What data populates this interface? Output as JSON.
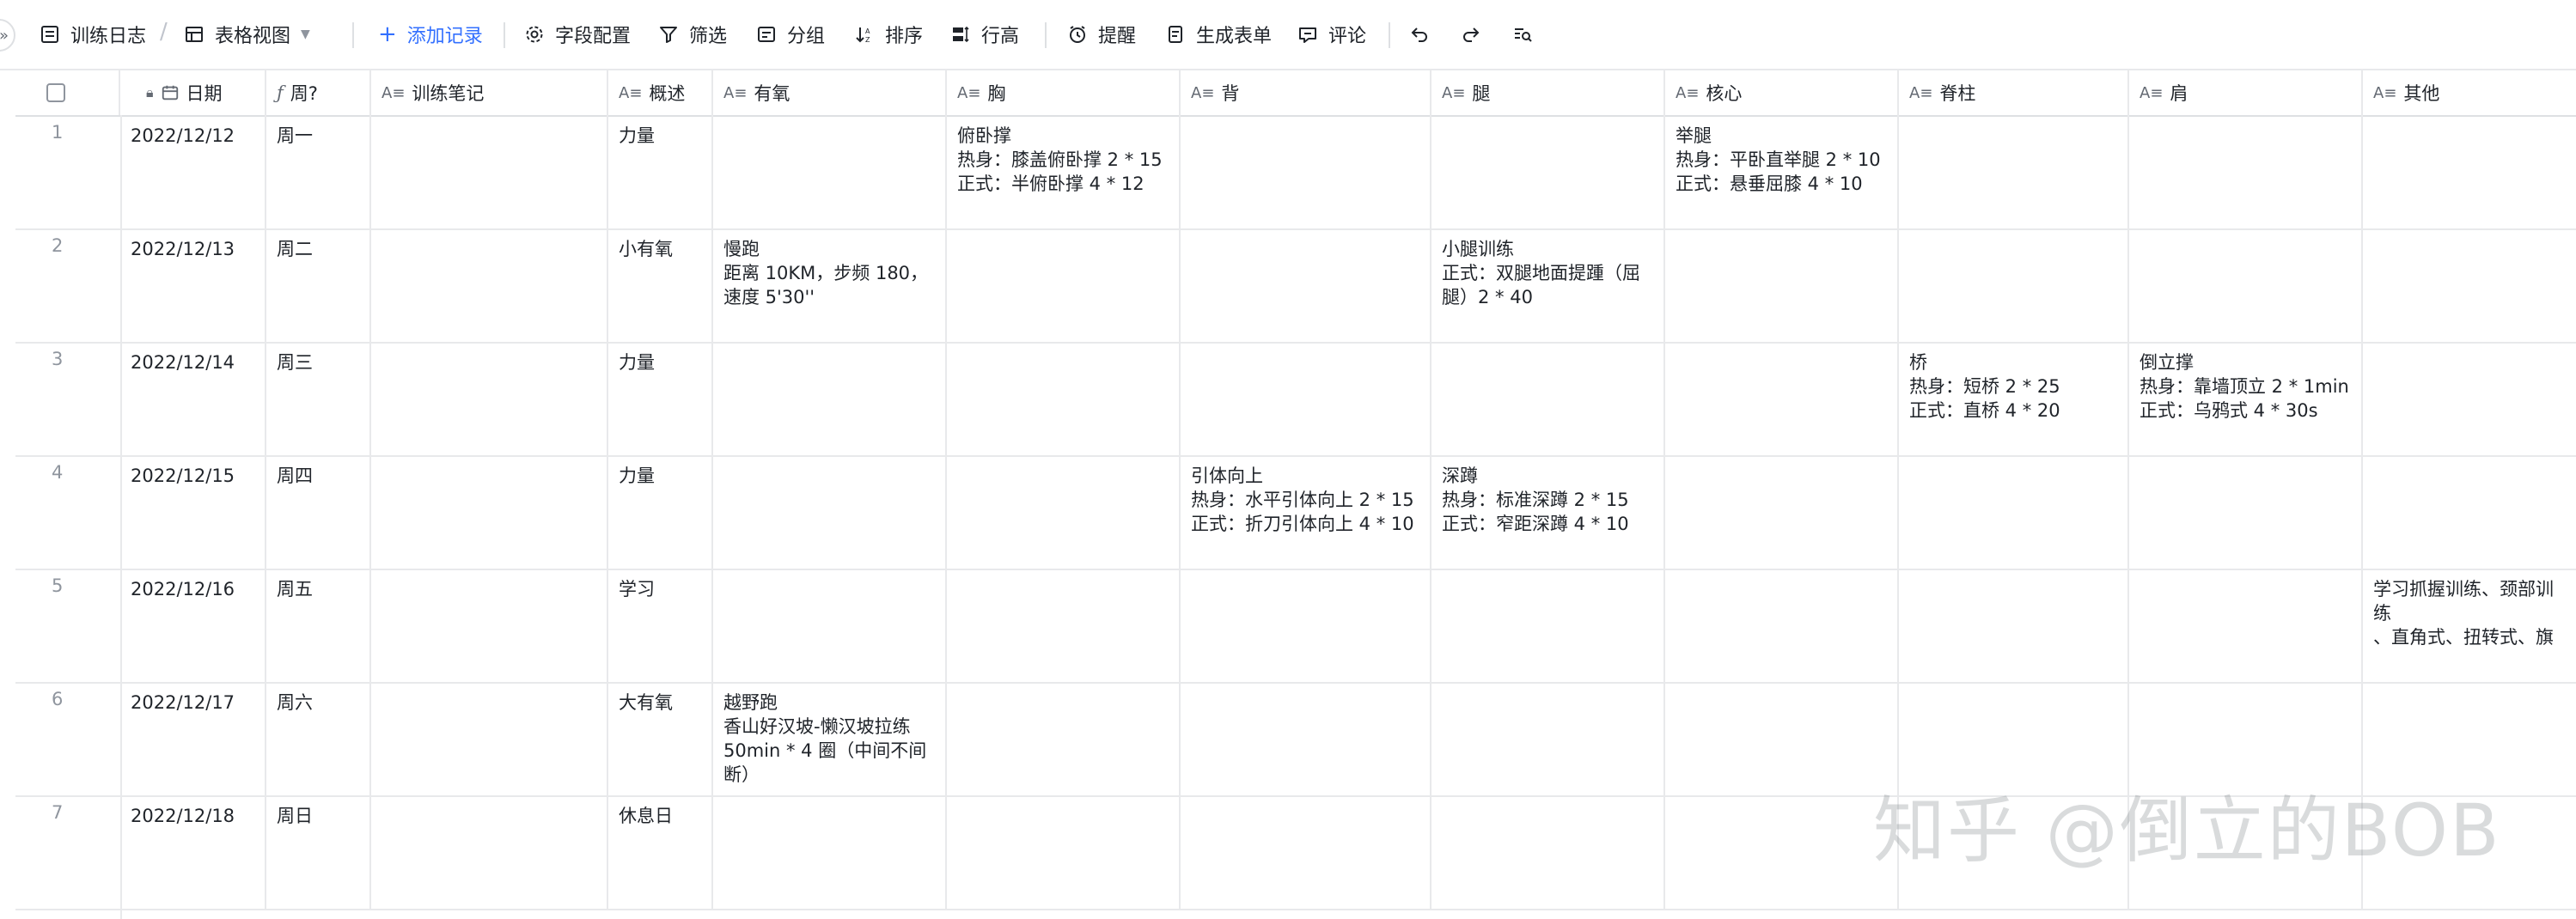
{
  "toolbar": {
    "table_name": "训练日志",
    "view_name": "表格视图",
    "add_record": "添加记录",
    "field_config": "字段配置",
    "filter": "筛选",
    "group": "分组",
    "sort": "排序",
    "row_height": "行高",
    "reminder": "提醒",
    "generate_form": "生成表单",
    "comment": "评论"
  },
  "columns": [
    {
      "key": "date",
      "label": "日期"
    },
    {
      "key": "weekday",
      "label": "周?"
    },
    {
      "key": "notes",
      "label": "训练笔记"
    },
    {
      "key": "summary",
      "label": "概述"
    },
    {
      "key": "cardio",
      "label": "有氧"
    },
    {
      "key": "chest",
      "label": "胸"
    },
    {
      "key": "back",
      "label": "背"
    },
    {
      "key": "legs",
      "label": "腿"
    },
    {
      "key": "core",
      "label": "核心"
    },
    {
      "key": "spine",
      "label": "脊柱"
    },
    {
      "key": "shoulder",
      "label": "肩"
    },
    {
      "key": "other",
      "label": "其他"
    }
  ],
  "rows": [
    {
      "num": "1",
      "date": "2022/12/12",
      "weekday": "周一",
      "notes": "",
      "summary": "力量",
      "cardio": "",
      "chest": "俯卧撑\n热身：膝盖俯卧撑 2 * 15\n正式：半俯卧撑 4 * 12",
      "back": "",
      "legs": "",
      "core": "举腿\n热身：平卧直举腿 2 * 10\n正式：悬垂屈膝 4 * 10",
      "spine": "",
      "shoulder": "",
      "other": ""
    },
    {
      "num": "2",
      "date": "2022/12/13",
      "weekday": "周二",
      "notes": "",
      "summary": "小有氧",
      "cardio": "慢跑\n距离 10KM，步频 180，\n速度 5'30''",
      "chest": "",
      "back": "",
      "legs": "小腿训练\n正式：双腿地面提踵（屈\n腿）2 * 40",
      "core": "",
      "spine": "",
      "shoulder": "",
      "other": ""
    },
    {
      "num": "3",
      "date": "2022/12/14",
      "weekday": "周三",
      "notes": "",
      "summary": "力量",
      "cardio": "",
      "chest": "",
      "back": "",
      "legs": "",
      "core": "",
      "spine": "桥\n热身：短桥 2 * 25\n正式：直桥 4 * 20",
      "shoulder": "倒立撑\n热身：靠墙顶立 2 * 1min\n正式：乌鸦式 4 * 30s",
      "other": ""
    },
    {
      "num": "4",
      "date": "2022/12/15",
      "weekday": "周四",
      "notes": "",
      "summary": "力量",
      "cardio": "",
      "chest": "",
      "back": "引体向上\n热身：水平引体向上 2 * 15\n正式：折刀引体向上 4 * 10",
      "legs": "深蹲\n热身：标准深蹲 2 * 15\n正式：窄距深蹲 4 * 10",
      "core": "",
      "spine": "",
      "shoulder": "",
      "other": ""
    },
    {
      "num": "5",
      "date": "2022/12/16",
      "weekday": "周五",
      "notes": "",
      "summary": "学习",
      "cardio": "",
      "chest": "",
      "back": "",
      "legs": "",
      "core": "",
      "spine": "",
      "shoulder": "",
      "other": "学习抓握训练、颈部训练\n、直角式、扭转式、旗"
    },
    {
      "num": "6",
      "date": "2022/12/17",
      "weekday": "周六",
      "notes": "",
      "summary": "大有氧",
      "cardio": "越野跑\n香山好汉坡-懒汉坡拉练\n50min * 4 圈（中间不间\n断）",
      "chest": "",
      "back": "",
      "legs": "",
      "core": "",
      "spine": "",
      "shoulder": "",
      "other": ""
    },
    {
      "num": "7",
      "date": "2022/12/18",
      "weekday": "周日",
      "notes": "",
      "summary": "休息日",
      "cardio": "",
      "chest": "",
      "back": "",
      "legs": "",
      "core": "",
      "spine": "",
      "shoulder": "",
      "other": ""
    }
  ],
  "watermark": "知乎 @倒立的BOB"
}
